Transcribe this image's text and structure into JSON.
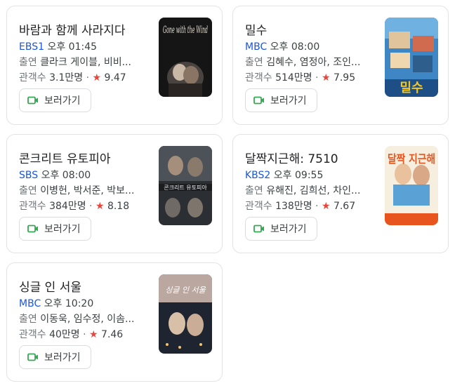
{
  "button_label": "보러가기",
  "labels": {
    "cast": "출연",
    "audience": "관객수",
    "star": "★"
  },
  "cards": [
    {
      "title": "바람과 함께 사라지다",
      "channel": "EBS1",
      "time": "오후 01:45",
      "cast": "클라크 게이블, 비비...",
      "audience": "3.1만명",
      "rating": "9.47",
      "poster_text": "Gone with the Wind"
    },
    {
      "title": "밀수",
      "channel": "MBC",
      "time": "오후 08:00",
      "cast": "김혜수, 염정아, 조인...",
      "audience": "514만명",
      "rating": "7.95",
      "poster_text": "밀수"
    },
    {
      "title": "콘크리트 유토피아",
      "channel": "SBS",
      "time": "오후 08:00",
      "cast": "이병헌, 박서준, 박보...",
      "audience": "384만명",
      "rating": "8.18",
      "poster_text": "콘크리트 유토피아"
    },
    {
      "title": "달짝지근해: 7510",
      "channel": "KBS2",
      "time": "오후 09:55",
      "cast": "유해진, 김희선, 차인...",
      "audience": "138만명",
      "rating": "7.67",
      "poster_text": "달짝 지근해"
    },
    {
      "title": "싱글 인 서울",
      "channel": "MBC",
      "time": "오후 10:20",
      "cast": "이동욱, 임수정, 이솜...",
      "audience": "40만명",
      "rating": "7.46",
      "poster_text": "싱글 인 서울"
    }
  ],
  "colors": {
    "channel": "#1a56db",
    "star": "#e8453c",
    "video_icon": "#34a853"
  },
  "icons": {
    "button": "video-camera-icon"
  }
}
